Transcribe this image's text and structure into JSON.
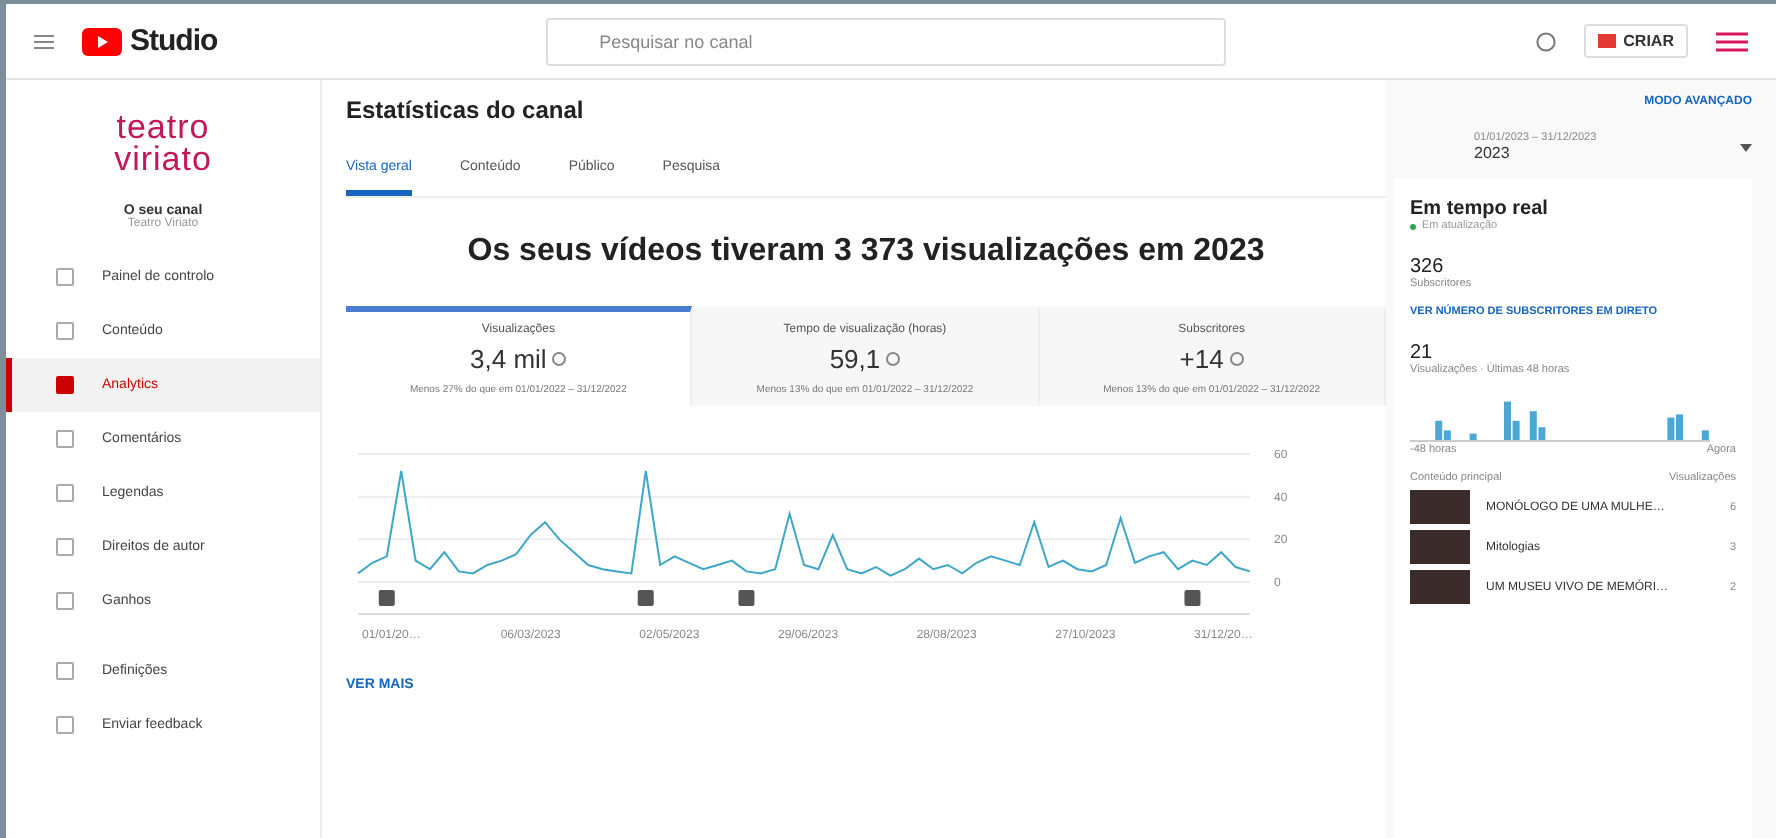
{
  "topbar": {
    "logo": "Studio",
    "search": {
      "placeholder": "Pesquisar no canal"
    },
    "create_button": "CRIAR"
  },
  "sidebar": {
    "channel_logo": [
      "teatro",
      "viriato"
    ],
    "channel_label": "O seu canal",
    "channel_name": "Teatro Viriato",
    "items": [
      {
        "label": "Painel de controlo",
        "selected": false
      },
      {
        "label": "Conteúdo",
        "selected": false
      },
      {
        "label": "Analytics",
        "selected": true
      },
      {
        "label": "Comentários",
        "selected": false
      },
      {
        "label": "Legendas",
        "selected": false
      },
      {
        "label": "Direitos de autor",
        "selected": false
      },
      {
        "label": "Ganhos",
        "selected": false
      }
    ],
    "footer_items": [
      {
        "label": "Definições"
      },
      {
        "label": "Enviar feedback"
      }
    ]
  },
  "header": {
    "title": "Estatísticas do canal",
    "advanced_mode": "MODO AVANÇADO",
    "date_range": "01/01/2023 – 31/12/2023",
    "period": "2023"
  },
  "tabs": [
    {
      "label": "Vista geral",
      "selected": true
    },
    {
      "label": "Conteúdo",
      "selected": false
    },
    {
      "label": "Público",
      "selected": false
    },
    {
      "label": "Pesquisa",
      "selected": false
    }
  ],
  "headline": "Os seus vídeos tiveram 3 373 visualizações em 2023",
  "metrics": [
    {
      "label": "Visualizações",
      "value": "3,4 mil",
      "note": "Menos 27% do que em 01/01/2022 – 31/12/2022",
      "selected": true
    },
    {
      "label": "Tempo de visualização (horas)",
      "value": "59,1",
      "note": "Menos 13% do que em 01/01/2022 – 31/12/2022",
      "selected": false
    },
    {
      "label": "Subscritores",
      "value": "+14",
      "note": "Menos 13% do que em 01/01/2022 – 31/12/2022",
      "selected": false
    }
  ],
  "chart": {
    "chart_data": {
      "type": "line",
      "ylim": [
        0,
        60
      ],
      "yticks": [
        0,
        20,
        40,
        60
      ],
      "values": [
        4,
        9,
        12,
        52,
        10,
        6,
        14,
        5,
        4,
        8,
        10,
        13,
        22,
        28,
        20,
        14,
        8,
        6,
        5,
        4,
        52,
        8,
        12,
        9,
        6,
        8,
        10,
        5,
        4,
        6,
        32,
        8,
        6,
        22,
        6,
        4,
        7,
        3,
        6,
        11,
        6,
        8,
        4,
        9,
        12,
        10,
        8,
        28,
        7,
        10,
        6,
        5,
        8,
        30,
        9,
        12,
        14,
        6,
        10,
        8,
        14,
        7,
        5
      ]
    },
    "x_labels": [
      "01/01/20…",
      "06/03/2023",
      "02/05/2023",
      "29/06/2023",
      "28/08/2023",
      "27/10/2023",
      "31/12/20…"
    ],
    "more_link": "VER MAIS"
  },
  "realtime": {
    "title": "Em tempo real",
    "status": "Em atualização",
    "subscribers": "326",
    "subscribers_label": "Subscritores",
    "live_link": "VER NÚMERO DE SUBSCRITORES EM DIRETO",
    "views": "21",
    "views_label": "Visualizações · Últimas 48 horas",
    "axis_start": "-48 horas",
    "axis_end": "Agora",
    "top_content_label": "Conteúdo principal",
    "top_views_label": "Visualizações",
    "top_content": [
      {
        "title": "MONÓLOGO DE UMA MULHE…",
        "views": "6"
      },
      {
        "title": "Mitologias",
        "views": "3"
      },
      {
        "title": "UM MUSEU VIVO DE MEMÓRI…",
        "views": "2"
      }
    ]
  }
}
